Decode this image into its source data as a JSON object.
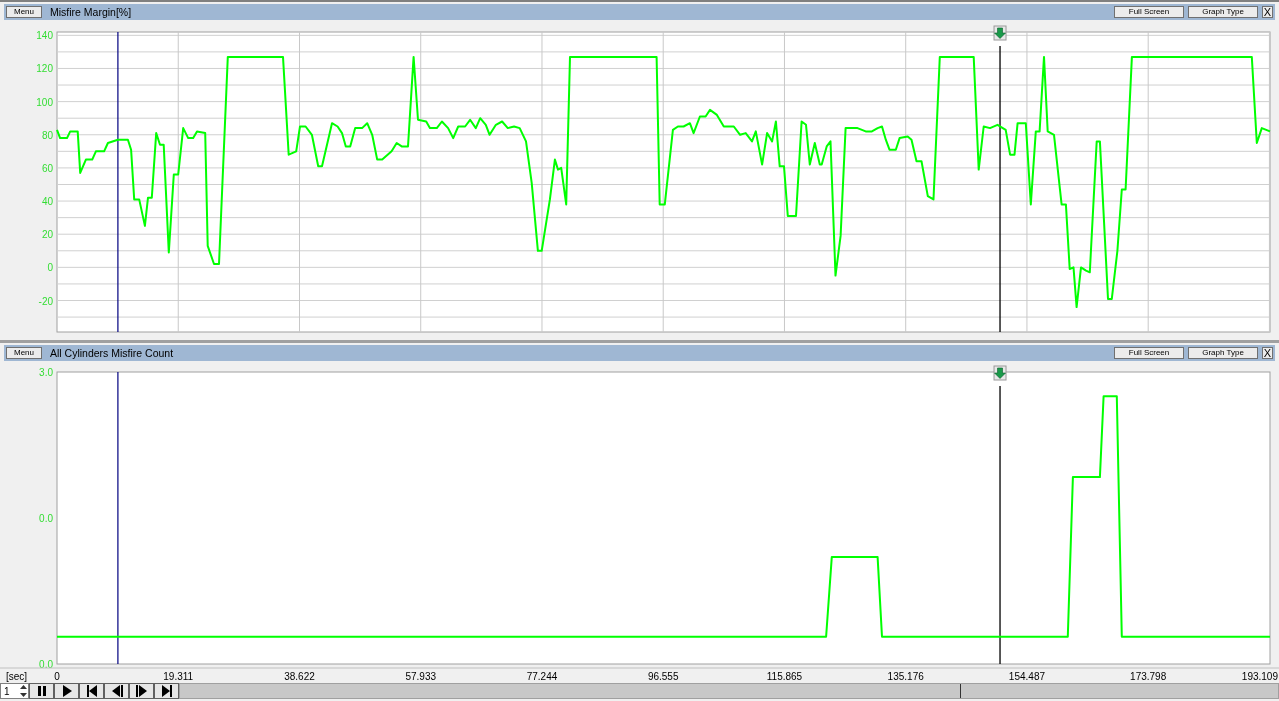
{
  "panels": [
    {
      "menu_button": "Menu",
      "full_screen_button": "Full Screen",
      "graph_type_button": "Graph Type",
      "close_button": "X",
      "chart_data": {
        "type": "line",
        "title": "Misfire Margin[%]",
        "xlim": [
          0,
          193.2
        ],
        "ylim": [
          -39,
          142
        ],
        "yticks": [
          {
            "value": -20,
            "label": "-20"
          },
          {
            "value": 0,
            "label": "0"
          },
          {
            "value": 20,
            "label": "20"
          },
          {
            "value": 40,
            "label": "40"
          },
          {
            "value": 60,
            "label": "60"
          },
          {
            "value": 80,
            "label": "80"
          },
          {
            "value": 100,
            "label": "100"
          },
          {
            "value": 120,
            "label": "120"
          },
          {
            "value": 140,
            "label": "140"
          }
        ],
        "x": [
          0,
          0.5,
          1.6,
          2.1,
          3.3,
          3.7,
          4.6,
          5.6,
          6.2,
          7.5,
          8.1,
          9.7,
          11.3,
          11.8,
          12.3,
          13.1,
          14.0,
          14.5,
          15.1,
          15.8,
          16.4,
          17.0,
          17.8,
          18.6,
          19.3,
          20.1,
          20.9,
          21.7,
          22.3,
          23.6,
          24.0,
          25.0,
          25.8,
          27.2,
          36.0,
          36.9,
          38.1,
          38.7,
          39.6,
          40.6,
          41.6,
          42.2,
          43.8,
          44.7,
          45.4,
          46.0,
          46.7,
          47.5,
          48.6,
          49.4,
          50.2,
          51.0,
          51.8,
          53.3,
          54.1,
          54.9,
          55.9,
          56.8,
          57.5,
          58.8,
          59.4,
          60.5,
          61.3,
          62.3,
          63.1,
          63.9,
          65.0,
          65.8,
          66.7,
          67.4,
          68.3,
          68.9,
          69.9,
          70.9,
          71.8,
          72.8,
          73.7,
          74.7,
          75.6,
          76.6,
          77.2,
          78.5,
          79.3,
          79.8,
          80.3,
          81.1,
          81.7,
          95.5,
          96.0,
          96.8,
          98.1,
          98.9,
          99.8,
          100.8,
          101.4,
          102.4,
          103.3,
          104.0,
          105.1,
          106.2,
          107.8,
          108.8,
          109.7,
          110.7,
          111.3,
          112.3,
          113.1,
          113.9,
          114.5,
          115.1,
          115.8,
          116.4,
          117.7,
          118.6,
          119.3,
          119.9,
          120.7,
          121.5,
          121.8,
          122.6,
          123.2,
          124.0,
          124.8,
          125.6,
          127.5,
          128.8,
          129.8,
          130.7,
          131.4,
          132.0,
          132.6,
          133.6,
          134.2,
          135.5,
          136.1,
          136.9,
          137.7,
          138.7,
          139.6,
          140.6,
          146.0,
          146.8,
          147.6,
          148.6,
          149.8,
          151.1,
          151.8,
          152.5,
          153.0,
          154.3,
          155.1,
          155.9,
          156.5,
          157.2,
          157.8,
          158.8,
          160.0,
          160.7,
          161.3,
          161.9,
          162.4,
          163.1,
          163.9,
          164.5,
          165.6,
          166.1,
          167.4,
          168.0,
          168.9,
          169.6,
          170.2,
          171.2,
          190.3,
          191.1,
          191.9,
          193.2
        ],
        "series": [
          {
            "color": "#00ff00",
            "values": [
              83,
              78,
              78,
              82,
              82,
              57,
              65,
              65,
              70,
              70,
              75,
              77,
              77,
              71,
              41,
              41,
              25,
              42,
              42,
              81,
              74,
              74,
              9,
              56,
              56,
              84,
              78,
              78,
              82,
              81,
              13,
              2,
              2,
              127,
              127,
              68,
              70,
              85,
              85,
              80,
              61,
              61,
              87,
              85,
              81,
              73,
              73,
              84,
              84,
              87,
              80,
              65,
              65,
              70,
              75,
              73,
              73,
              127,
              89,
              88,
              84,
              84,
              88,
              84,
              78,
              85,
              85,
              89,
              84,
              90,
              86,
              80,
              86,
              88,
              84,
              85,
              84,
              76,
              51,
              10,
              10,
              41,
              65,
              59,
              60,
              38,
              127,
              127,
              38,
              38,
              83,
              85,
              85,
              87,
              81,
              91,
              91,
              95,
              92,
              85,
              85,
              80,
              81,
              76,
              82,
              62,
              81,
              76,
              88,
              61,
              61,
              31,
              31,
              88,
              86,
              62,
              75,
              62,
              62,
              73,
              76,
              -5,
              19,
              84,
              84,
              82,
              82,
              84,
              85,
              77,
              71,
              71,
              78,
              79,
              77,
              64,
              64,
              43,
              41,
              127,
              127,
              59,
              85,
              84,
              86,
              83,
              68,
              68,
              87,
              87,
              38,
              82,
              82,
              127,
              82,
              80,
              38,
              38,
              -1,
              0,
              -24,
              0,
              -2,
              -3,
              76,
              76,
              -19,
              -19,
              10,
              47,
              47,
              127,
              127,
              75,
              84,
              82
            ]
          }
        ],
        "grid": true,
        "ref_lines": [
          {
            "axis": "x",
            "value": 9.7,
            "color": "#000080"
          },
          {
            "axis": "x",
            "value": 150.2,
            "color": "#000000"
          }
        ]
      }
    },
    {
      "menu_button": "Menu",
      "full_screen_button": "Full Screen",
      "graph_type_button": "Graph Type",
      "close_button": "X",
      "mid_axis_label": "0.0",
      "chart_data": {
        "type": "line",
        "title": "All Cylinders Misfire Count",
        "xlabel": "[sec]",
        "xlim": [
          0,
          193.2
        ],
        "ylim": [
          0,
          3
        ],
        "yticks": [
          {
            "value": 0,
            "label": "0.0"
          },
          {
            "value": 3,
            "label": "3.0"
          }
        ],
        "xticks": [
          {
            "value": 0,
            "label": "0"
          },
          {
            "value": 19.311,
            "label": "19.311"
          },
          {
            "value": 38.622,
            "label": "38.622"
          },
          {
            "value": 57.933,
            "label": "57.933"
          },
          {
            "value": 77.244,
            "label": "77.244"
          },
          {
            "value": 96.555,
            "label": "96.555"
          },
          {
            "value": 115.865,
            "label": "115.865"
          },
          {
            "value": 135.176,
            "label": "135.176"
          },
          {
            "value": 154.487,
            "label": "154.487"
          },
          {
            "value": 173.798,
            "label": "173.798"
          },
          {
            "value": 193.109,
            "label": "193.109"
          }
        ],
        "x": [
          0,
          122.5,
          123.4,
          130.7,
          131.4,
          161.0,
          161.8,
          166.1,
          166.7,
          168.8,
          169.6,
          193.2
        ],
        "series": [
          {
            "color": "#00ff00",
            "values": [
              0.28,
              0.28,
              1.1,
              1.1,
              0.28,
              0.28,
              1.92,
              1.92,
              2.75,
              2.75,
              0.28,
              0.28
            ]
          }
        ],
        "ref_lines": [
          {
            "axis": "x",
            "value": 9.7,
            "color": "#000080"
          },
          {
            "axis": "x",
            "value": 150.2,
            "color": "#000000"
          }
        ]
      }
    }
  ],
  "playback": {
    "speed": "1",
    "buttons": [
      {
        "kind": "pause"
      },
      {
        "kind": "play"
      },
      {
        "kind": "first"
      },
      {
        "kind": "back"
      },
      {
        "kind": "forward"
      },
      {
        "kind": "last"
      }
    ]
  }
}
